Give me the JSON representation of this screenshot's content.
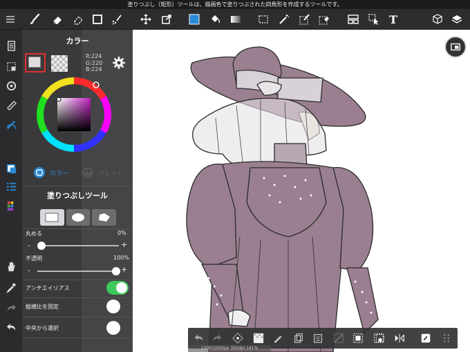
{
  "status_bar": {
    "text": "塗りつぶし（矩形）ツールは、描画色で塗りつぶされた四角形を作成するツールです。"
  },
  "colors": {
    "accent_blue": "#2a8ad8",
    "toggle_green": "#3ec95a",
    "selected_swatch_border": "#e03030",
    "dress": "#9a7f91"
  },
  "toolbar": {
    "icons": [
      "menu-icon",
      "brush-icon",
      "eraser-icon",
      "blur-icon",
      "rectangle-shape-icon",
      "dot-pen-icon",
      "move-icon",
      "transform-icon",
      "color-swatch-icon",
      "fill-bucket-icon",
      "gradient-icon",
      "select-rect-icon",
      "magic-wand-icon",
      "select-pen-icon",
      "select-eraser-icon",
      "frame-icon",
      "operation-icon",
      "text-icon",
      "materials-icon",
      "layers-icon"
    ]
  },
  "left_sidebar": {
    "icons": [
      "pages-icon",
      "selection-icon",
      "rotate-icon",
      "ruler-icon",
      "snap-icon",
      "color-panel-icon",
      "brush-list-icon",
      "layer-palette-icon",
      "hand-icon",
      "eyedropper-icon",
      "redo-icon",
      "undo-icon"
    ]
  },
  "color_panel": {
    "title": "カラー",
    "r_label": "R:224",
    "g_label": "G:220",
    "b_label": "B:224",
    "foreground_hex": "#e0dce0",
    "tab_color": "カラー",
    "tab_palette": "パレット"
  },
  "tool_panel": {
    "title": "塗りつぶしツール",
    "shapes": [
      "rectangle",
      "ellipse",
      "polygon"
    ],
    "round_label": "丸める",
    "round_value": "0%",
    "round_level": 0.0,
    "opacity_label": "不透明",
    "opacity_value": "100%",
    "opacity_level": 1.0,
    "antialias_label": "アンチエイリアス",
    "antialias_on": true,
    "keep_ratio_label": "縦横比を固定",
    "keep_ratio_on": false,
    "from_center_label": "中央から選択",
    "from_center_on": false,
    "minus": "-",
    "plus": "+"
  },
  "canvas": {
    "size_text": "1200*2000px 350dpi 141%"
  },
  "bottom_toolbar": {
    "icons": [
      "undo-icon",
      "redo-icon",
      "transform-icon",
      "fill-swatch-icon",
      "pen-icon",
      "copy-icon",
      "paste-icon",
      "clear-icon",
      "invert-icon",
      "select-all-icon",
      "snapshot-icon",
      "flip-icon",
      "edit-icon",
      "more-icon"
    ]
  }
}
